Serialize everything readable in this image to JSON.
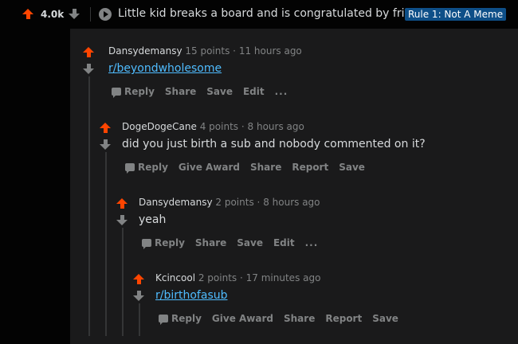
{
  "post": {
    "score": "4.0k",
    "title": "Little kid breaks a board and is congratulated by friends",
    "flair": "Rule 1: Not A Meme"
  },
  "comments": [
    {
      "author": "Dansydemansy",
      "points": "15 points",
      "time": "11 hours ago",
      "body": "r/beyondwholesome",
      "actions": [
        "Reply",
        "Share",
        "Save",
        "Edit",
        "..."
      ]
    },
    {
      "author": "DogeDogeCane",
      "points": "4 points",
      "time": "8 hours ago",
      "body": "did you just birth a sub and nobody commented on it?",
      "actions": [
        "Reply",
        "Give Award",
        "Share",
        "Report",
        "Save"
      ]
    },
    {
      "author": "Dansydemansy",
      "points": "2 points",
      "time": "8 hours ago",
      "body": "yeah",
      "actions": [
        "Reply",
        "Share",
        "Save",
        "Edit",
        "..."
      ]
    },
    {
      "author": "Kcincool",
      "points": "2 points",
      "time": "17 minutes ago",
      "body": "r/birthofasub",
      "actions": [
        "Reply",
        "Give Award",
        "Share",
        "Report",
        "Save"
      ]
    }
  ],
  "separator": "·"
}
